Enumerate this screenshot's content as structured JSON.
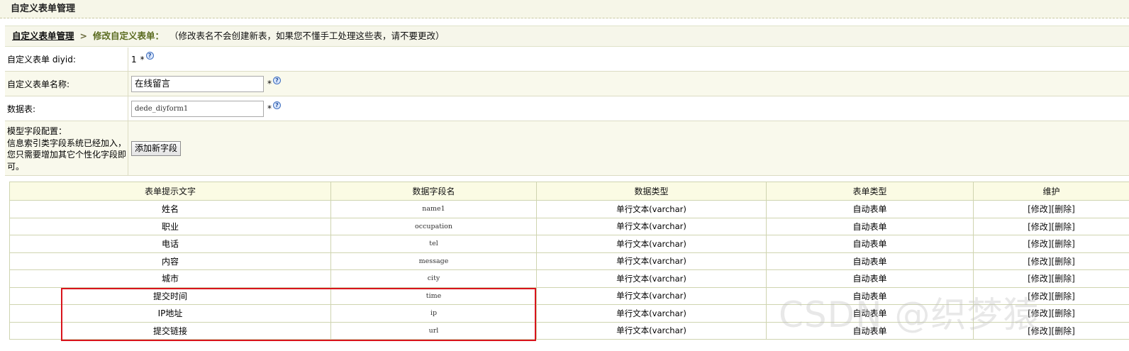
{
  "header": {
    "title": "自定义表单管理"
  },
  "breadcrumb": {
    "parent": "自定义表单管理",
    "separator": ">",
    "current": "修改自定义表单：",
    "note": "（修改表名不会创建新表，如果您不懂手工处理这些表，请不要更改）"
  },
  "form": {
    "diyid": {
      "label": "自定义表单 diyid:",
      "value": "1",
      "required_mark": "*"
    },
    "name": {
      "label": "自定义表单名称:",
      "value": "在线留言",
      "required_mark": "*"
    },
    "table": {
      "label": "数据表:",
      "value": "dede_diyform1",
      "required_mark": "*"
    },
    "fields_config": {
      "label_line1": "模型字段配置：",
      "label_line2": "信息索引类字段系统已经加入，",
      "label_line3": "您只需要增加其它个性化字段即",
      "label_line4": "可。",
      "add_button": "添加新字段"
    }
  },
  "help_icon": {
    "glyph": "?",
    "icon": "help-icon"
  },
  "table": {
    "headers": [
      "表单提示文字",
      "数据字段名",
      "数据类型",
      "表单类型",
      "维护"
    ],
    "rows": [
      {
        "label": "姓名",
        "field": "name1",
        "dtype": "单行文本(varchar)",
        "ftype": "自动表单",
        "edit": "[修改]",
        "delete": "[删除]"
      },
      {
        "label": "职业",
        "field": "occupation",
        "dtype": "单行文本(varchar)",
        "ftype": "自动表单",
        "edit": "[修改]",
        "delete": "[删除]"
      },
      {
        "label": "电话",
        "field": "tel",
        "dtype": "单行文本(varchar)",
        "ftype": "自动表单",
        "edit": "[修改]",
        "delete": "[删除]"
      },
      {
        "label": "内容",
        "field": "message",
        "dtype": "单行文本(varchar)",
        "ftype": "自动表单",
        "edit": "[修改]",
        "delete": "[删除]"
      },
      {
        "label": "城市",
        "field": "city",
        "dtype": "单行文本(varchar)",
        "ftype": "自动表单",
        "edit": "[修改]",
        "delete": "[删除]"
      },
      {
        "label": "提交时间",
        "field": "time",
        "dtype": "单行文本(varchar)",
        "ftype": "自动表单",
        "edit": "[修改]",
        "delete": "[删除]"
      },
      {
        "label": "IP地址",
        "field": "ip",
        "dtype": "单行文本(varchar)",
        "ftype": "自动表单",
        "edit": "[修改]",
        "delete": "[删除]"
      },
      {
        "label": "提交链接",
        "field": "url",
        "dtype": "单行文本(varchar)",
        "ftype": "自动表单",
        "edit": "[修改]",
        "delete": "[删除]"
      }
    ]
  },
  "watermark": {
    "text": "CSDN @织梦猿"
  },
  "colors": {
    "highlight": "#d9141c",
    "header_bg": "#f6f6e8",
    "row_cream": "#f9f9ec"
  }
}
